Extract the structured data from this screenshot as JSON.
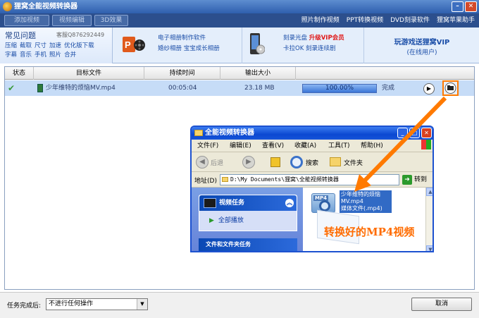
{
  "window": {
    "title": "狸窝全能视频转换器"
  },
  "toolbar": {
    "buttons": [
      "添加视频",
      "视频编辑",
      "3D效果"
    ],
    "links": [
      "照片制作视频",
      "PPT转换视频",
      "DVD刻录软件",
      "狸窝苹果助手"
    ]
  },
  "faq": {
    "title": "常见问题",
    "qq": "客服Q876292449",
    "links": [
      "压缩",
      "截取",
      "尺寸",
      "加速",
      "优化版下载",
      "字幕",
      "音乐",
      "手机",
      "照片",
      "合并"
    ]
  },
  "ads": {
    "ad1": [
      "电子相册制作软件",
      "婚纱相册 宝宝成长相册"
    ],
    "ad2_line1": "刻录光盘",
    "ad2_vip": "升级VIP会员",
    "ad2_line2": "卡拉OK 刻录连续剧",
    "ad3_title": "玩游戏送狸窝VIP",
    "ad3_sub": "(在线用户)"
  },
  "table": {
    "headers": [
      "状态",
      "目标文件",
      "持续时间",
      "输出大小"
    ],
    "rows": [
      {
        "file": "少年维特的烦恼MV.mp4",
        "duration": "00:05:04",
        "size": "23.18 MB",
        "progress_label": "100.00%",
        "progress": 1.0,
        "status": "完成"
      }
    ]
  },
  "explorer": {
    "title": "全能视频转换器",
    "menu": [
      "文件(F)",
      "编辑(E)",
      "查看(V)",
      "收藏(A)",
      "工具(T)",
      "帮助(H)"
    ],
    "back": "后退",
    "search": "搜索",
    "folders": "文件夹",
    "address_label": "地址(D)",
    "address": "D:\\My Documents\\狸窝\\全能视频转换器",
    "go": "转到",
    "task_title": "视频任务",
    "task_item": "全部播放",
    "task2_title": "文件和文件夹任务",
    "file_tag": "MP4",
    "file_name": "少年维特的烦恼MV.mp4",
    "file_type": "媒体文件(.mp4)"
  },
  "annotation": "转换好的MP4视频",
  "footer": {
    "label": "任务完成后:",
    "select_value": "不进行任何操作",
    "cancel": "取消"
  },
  "colors": {
    "accent": "#ff7a00",
    "title_blue": "#2f5fae",
    "selection": "#c6dcf7"
  }
}
